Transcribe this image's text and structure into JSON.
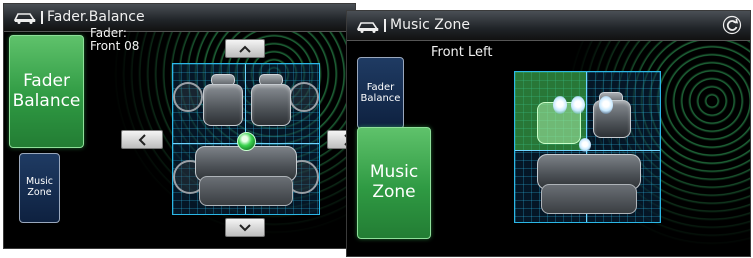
{
  "panels": {
    "fader": {
      "title": "Fader.Balance",
      "icon": "car-audio-icon",
      "buttons": {
        "fader_balance_label": "Fader\nBalance",
        "music_zone_label": "Music\nZone"
      },
      "status_text": "Fader:\nFront 08",
      "arrows": {
        "up": "chevron-up-icon",
        "down": "chevron-down-icon",
        "left": "chevron-left-icon",
        "right": "chevron-right-icon"
      }
    },
    "music": {
      "title": "Music Zone",
      "icon": "car-audio-icon",
      "buttons": {
        "fader_balance_label": "Fader\nBalance",
        "music_zone_label": "Music\nZone"
      },
      "zone_text": "Front Left",
      "refresh_icon": "refresh-icon"
    }
  },
  "colors": {
    "accent_green": "#3da84e",
    "inactive_blue": "#14294a",
    "grid_cyan": "#2bb7e6",
    "wave_green": "#3cc86e"
  }
}
